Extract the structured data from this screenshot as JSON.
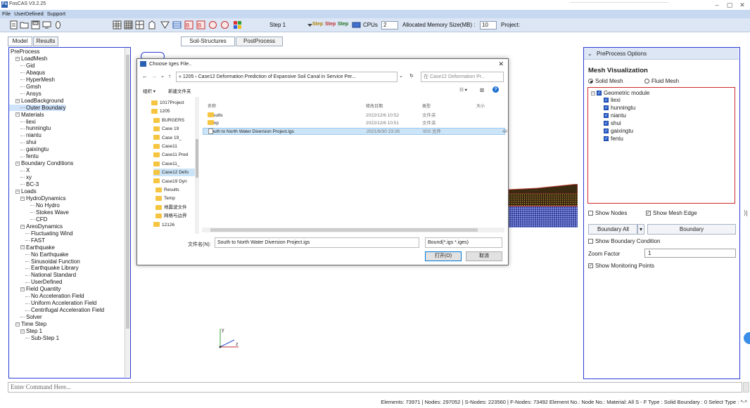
{
  "window": {
    "title": "FosCAS V3.2.25",
    "logo_text": "Fs",
    "controls": [
      "–",
      "▢",
      "✕"
    ]
  },
  "menu": [
    "File",
    "UserDefined",
    "Support"
  ],
  "toolbar": {
    "step_label": "Step 1",
    "step_buttons": [
      "Step",
      "Step",
      "Step"
    ],
    "cpus_label": "CPUs",
    "cpus_value": "2",
    "memory_label": "Allocated Memory Size(MB) :",
    "memory_value": "10",
    "project_label": "Project:"
  },
  "left_tabs": {
    "model": "Model",
    "results": "Results"
  },
  "center_tabs": {
    "soil": "Soil-Structures",
    "post": "PostProcess"
  },
  "tree": [
    {
      "label": "PreProcess",
      "indent": 0,
      "kind": "root"
    },
    {
      "label": "LoadMesh",
      "indent": 1,
      "kind": "expander"
    },
    {
      "label": "Gid",
      "indent": 2,
      "kind": "leaf"
    },
    {
      "label": "Abaqus",
      "indent": 2,
      "kind": "leaf"
    },
    {
      "label": "HyperMesh",
      "indent": 2,
      "kind": "leaf"
    },
    {
      "label": "Gmsh",
      "indent": 2,
      "kind": "leaf"
    },
    {
      "label": "Ansys",
      "indent": 2,
      "kind": "leaf"
    },
    {
      "label": "LoadBackground",
      "indent": 1,
      "kind": "expander"
    },
    {
      "label": "Outer Boundary",
      "indent": 2,
      "kind": "selected"
    },
    {
      "label": "Materials",
      "indent": 1,
      "kind": "expander"
    },
    {
      "label": "liexi",
      "indent": 2,
      "kind": "leaf"
    },
    {
      "label": "hunningtu",
      "indent": 2,
      "kind": "leaf"
    },
    {
      "label": "niantu",
      "indent": 2,
      "kind": "leaf"
    },
    {
      "label": "shui",
      "indent": 2,
      "kind": "leaf"
    },
    {
      "label": "gaixingtu",
      "indent": 2,
      "kind": "leaf"
    },
    {
      "label": "fentu",
      "indent": 2,
      "kind": "leaf"
    },
    {
      "label": "Boundary Conditions",
      "indent": 1,
      "kind": "expander"
    },
    {
      "label": "X",
      "indent": 2,
      "kind": "leaf"
    },
    {
      "label": "xy",
      "indent": 2,
      "kind": "leaf"
    },
    {
      "label": "BC-3",
      "indent": 2,
      "kind": "leaf"
    },
    {
      "label": "Loads",
      "indent": 1,
      "kind": "expander"
    },
    {
      "label": "HydroDynamics",
      "indent": 2,
      "kind": "expander"
    },
    {
      "label": "No Hydro",
      "indent": 4,
      "kind": "leaf"
    },
    {
      "label": "Stokes Wave",
      "indent": 4,
      "kind": "leaf"
    },
    {
      "label": "CFD",
      "indent": 4,
      "kind": "leaf"
    },
    {
      "label": "AreoDynamics",
      "indent": 2,
      "kind": "expander"
    },
    {
      "label": "Fluctuating Wind",
      "indent": 3,
      "kind": "leaf"
    },
    {
      "label": "FAST",
      "indent": 3,
      "kind": "leaf"
    },
    {
      "label": "Earthquake",
      "indent": 2,
      "kind": "expander"
    },
    {
      "label": "No Earthquake",
      "indent": 3,
      "kind": "leaf"
    },
    {
      "label": "Sinusoidal Function",
      "indent": 3,
      "kind": "leaf"
    },
    {
      "label": "Earthquake Library",
      "indent": 3,
      "kind": "leaf"
    },
    {
      "label": "National Standard",
      "indent": 3,
      "kind": "leaf"
    },
    {
      "label": "UserDefined",
      "indent": 3,
      "kind": "leaf"
    },
    {
      "label": "Field Quantity",
      "indent": 2,
      "kind": "expander"
    },
    {
      "label": "No Acceleration Field",
      "indent": 3,
      "kind": "leaf"
    },
    {
      "label": "Uniform Acceleration Field",
      "indent": 3,
      "kind": "leaf"
    },
    {
      "label": "Centrifugal Acceleration Field",
      "indent": 3,
      "kind": "leaf"
    },
    {
      "label": "Solver",
      "indent": 2,
      "kind": "leaf"
    },
    {
      "label": "Time Step",
      "indent": 1,
      "kind": "expander"
    },
    {
      "label": "Step 1",
      "indent": 2,
      "kind": "expander"
    },
    {
      "label": "Sub-Step 1",
      "indent": 3,
      "kind": "leaf"
    }
  ],
  "dialog": {
    "title": "Choose Iges File..",
    "path": "« 1205 › Case12 Deformation Prediction of Expansive Soil Canal in Service Per...",
    "search_placeholder": "在 Case12 Deformation Pr...",
    "organize": "组织 ▾",
    "new_folder": "新建文件夹",
    "nav_items": [
      {
        "label": "1017Project",
        "indent": 0
      },
      {
        "label": "1205",
        "indent": 0
      },
      {
        "label": "BURGERS",
        "indent": 1
      },
      {
        "label": "Case 19",
        "indent": 1
      },
      {
        "label": "Case 19_",
        "indent": 1
      },
      {
        "label": "Case11",
        "indent": 1
      },
      {
        "label": "Case11 Pred",
        "indent": 1
      },
      {
        "label": "Case11_",
        "indent": 1
      },
      {
        "label": "Case12 Defo",
        "indent": 1
      },
      {
        "label": "Case19 Dyn",
        "indent": 1
      },
      {
        "label": "Results",
        "indent": 2
      },
      {
        "label": "Temp",
        "indent": 2
      },
      {
        "label": "地震波文件",
        "indent": 2
      },
      {
        "label": "网格与边界",
        "indent": 2
      },
      {
        "label": "12126",
        "indent": 1
      }
    ],
    "columns": {
      "name": "名称",
      "date": "修改日期",
      "type": "类型",
      "size": "大小"
    },
    "files": [
      {
        "name": "Results",
        "date": "2022/12/6 10:52",
        "type": "文件夹",
        "size": "",
        "kind": "folder"
      },
      {
        "name": "Temp",
        "date": "2022/12/6 10:51",
        "type": "文件夹",
        "size": "",
        "kind": "folder"
      },
      {
        "name": "South to North Water Diversion Project.igs",
        "date": "2021/6/30 23:26",
        "type": "IGS 文件",
        "size": "48",
        "kind": "file"
      }
    ],
    "filename_label": "文件名(N):",
    "filename_value": "South to North Water Diversion Project.igs",
    "filter_value": "Bound(*.igs *.iges)",
    "open_button": "打开(O)",
    "cancel_button": "取消"
  },
  "right_panel": {
    "header": "PreProcess Options",
    "mesh_visualization": "Mesh Visualization",
    "solid_mesh": "Solid Mesh",
    "fluid_mesh": "Fluid Mesh",
    "geometric_module": "Geometric module",
    "materials": [
      "liexi",
      "hunningtu",
      "niantu",
      "shui",
      "gaixingtu",
      "fentu"
    ],
    "show_nodes": "Show Nodes",
    "show_mesh_edge": "Show Mesh Edge",
    "boundary_all": "Boundary All",
    "boundary": "Boundary",
    "show_boundary_condition": "Show Boundary Condition",
    "zoom_factor_label": "Zoom Factor",
    "zoom_factor_value": "1",
    "show_monitoring_points": "Show Monitoring Points"
  },
  "command_placeholder": "Enter Command Here...",
  "status": "Elements: 73971 | Nodes: 297052 | S-Nodes: 223560 | F-Nodes: 73492 Element No.: Node No.: Material: All S - F Type : Solid Boundary : 0 Select Type : ^-^",
  "colors": {
    "menu_bg": "#c7d9f1",
    "panel_border": "#2c3ed6",
    "geo_box_border": "#d02a2a",
    "check_blue": "#2860d0"
  }
}
